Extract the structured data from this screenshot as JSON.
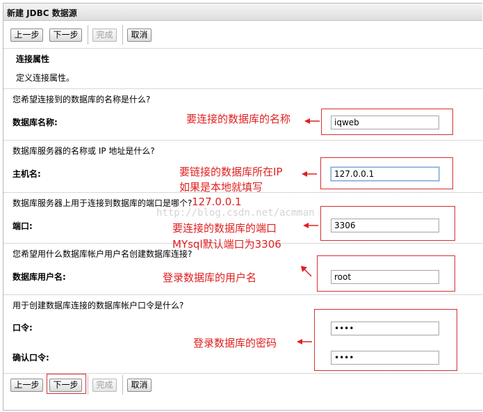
{
  "window": {
    "title": "新建 JDBC 数据源"
  },
  "toolbar": {
    "prev_label": "上一步",
    "next_label": "下一步",
    "finish_label": "完成",
    "cancel_label": "取消"
  },
  "section": {
    "heading": "连接属性",
    "description": "定义连接属性。"
  },
  "fields": {
    "db_name": {
      "question": "您希望连接到的数据库的名称是什么?",
      "label": "数据库名称:",
      "value": "iqweb"
    },
    "host": {
      "question": "数据库服务器的名称或 IP 地址是什么?",
      "label": "主机名:",
      "value": "127.0.0.1"
    },
    "port": {
      "question": "数据库服务器上用于连接到数据库的端口是哪个?",
      "label": "端口:",
      "value": "3306"
    },
    "user": {
      "question": "您希望用什么数据库帐户用户名创建数据库连接?",
      "label": "数据库用户名:",
      "value": "root"
    },
    "password": {
      "question": "用于创建数据库连接的数据库帐户口令是什么?",
      "label": "口令:",
      "value": "••••"
    },
    "confirm": {
      "label": "确认口令:",
      "value": "••••"
    }
  },
  "annotations": {
    "db_name": "要连接的数据库的名称",
    "host_line1": "要链接的数据库所在IP",
    "host_line2": "如果是本地就填写",
    "host_line3": "127.0.0.1",
    "port_line1": "要连接的数据库的端口",
    "port_line2": "MYsql默认端口为3306",
    "user": "登录数据库的用户名",
    "password": "登录数据库的密码"
  },
  "watermark": "http://blog.csdn.net/acmman",
  "colors": {
    "annotation_red": "#e02020"
  }
}
